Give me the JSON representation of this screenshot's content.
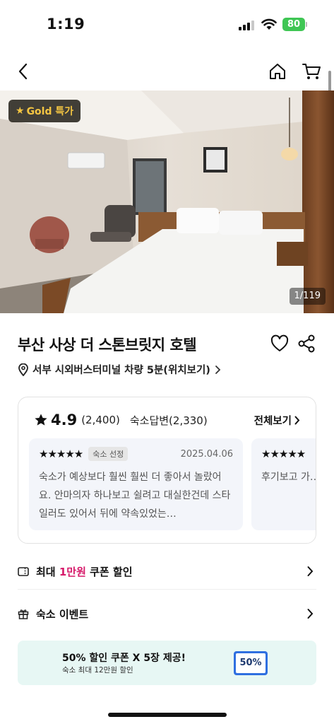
{
  "status_bar": {
    "time": "1:19",
    "battery": "80"
  },
  "hero": {
    "badge": "Gold 특가",
    "counter": "1/119"
  },
  "hotel": {
    "name": "부산 사상 더 스톤브릿지 호텔",
    "location": "서부 시외버스터미널 차량 5분(위치보기)"
  },
  "reviews": {
    "score": "4.9",
    "count": "(2,400)",
    "host_replies": "숙소답변(2,330)",
    "see_all": "전체보기",
    "items": [
      {
        "stars": "★★★★★",
        "tag": "숙소 선정",
        "date": "2025.04.06",
        "text": "숙소가 예상보다 훨씬 훨씬 더 좋아서 놀랐어요. 안마의자 하나보고 쉴려고 대실한건데 스타일러도 있어서 뒤에 약속있었는…"
      },
      {
        "stars": "★★★★★",
        "tag": "",
        "date": "",
        "text": "후기보고 가… 좋네요~~~… 도 별미^^♡"
      }
    ]
  },
  "rows": {
    "coupon_prefix": "최대 ",
    "coupon_highlight": "1만원",
    "coupon_suffix": " 쿠폰 할인",
    "event": "숙소 이벤트"
  },
  "promo": {
    "title": "50% 할인 쿠폰 X 5장 제공!",
    "subtitle": "숙소 최대 12만원 할인",
    "coupon": "50%"
  },
  "colors": {
    "highlight": "#d61a6a",
    "battery": "#3fc654",
    "promo_bg": "#e7f7f4",
    "gold": "#f4c542"
  },
  "icons": [
    "back-icon",
    "home-icon",
    "cart-icon",
    "heart-icon",
    "share-icon",
    "location-pin-icon",
    "star-icon",
    "chevron-right-icon",
    "coupon-icon",
    "gift-icon"
  ]
}
